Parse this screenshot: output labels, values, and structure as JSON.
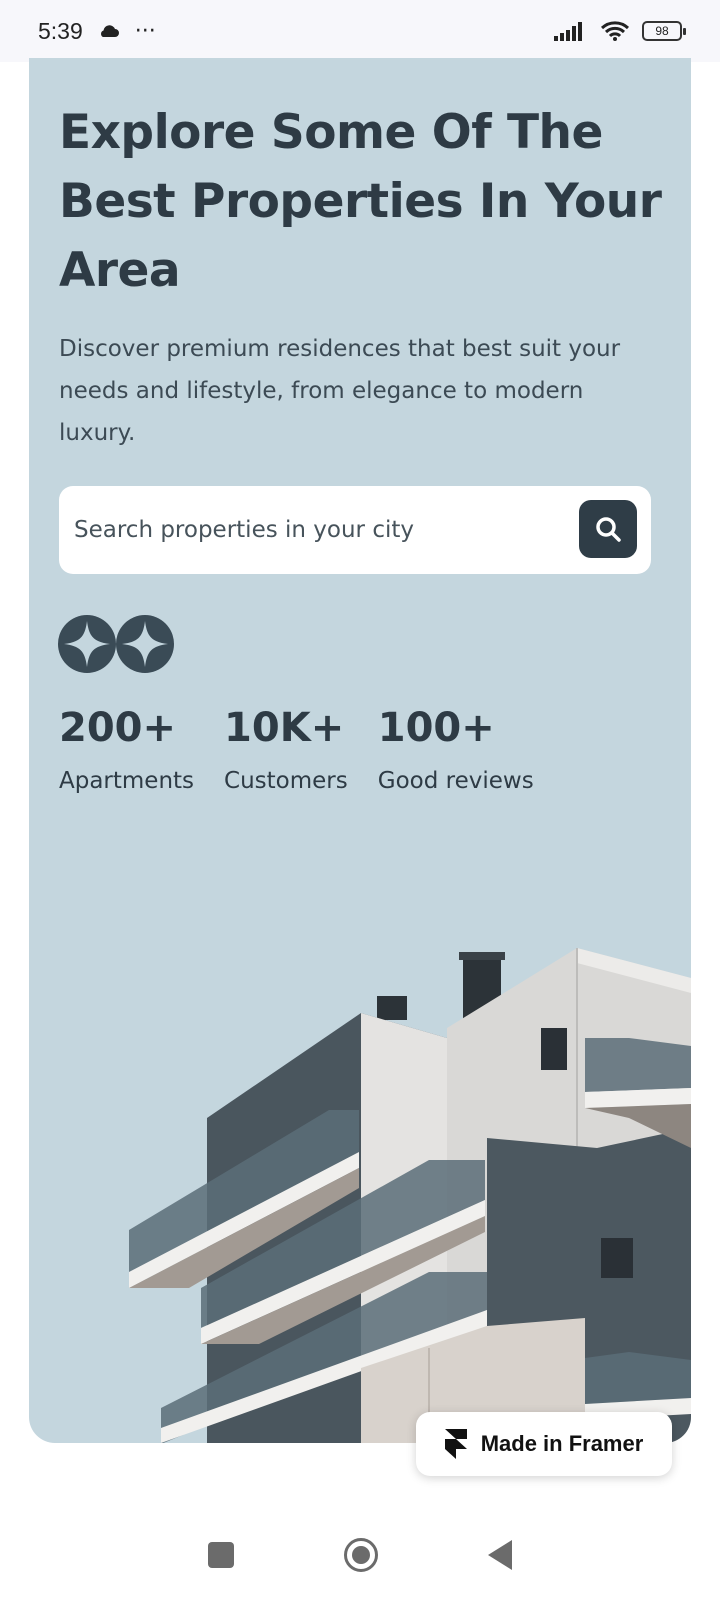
{
  "status_bar": {
    "time": "5:39",
    "more": "···",
    "battery": "98"
  },
  "hero": {
    "title": "Explore Some Of The Best Properties In Your Area",
    "description": "Discover premium residences that best suit your needs and lifestyle, from elegance to modern luxury."
  },
  "search": {
    "placeholder": "Search properties in your city"
  },
  "stats": [
    {
      "value": "200+",
      "label": "Apartments"
    },
    {
      "value": "10K+",
      "label": "Customers"
    },
    {
      "value": "100+",
      "label": "Good reviews"
    }
  ],
  "framer_badge": {
    "label": "Made in Framer"
  },
  "colors": {
    "card_background": "#c4d6de",
    "heading": "#2e3b45",
    "search_button": "#2f3d47"
  }
}
